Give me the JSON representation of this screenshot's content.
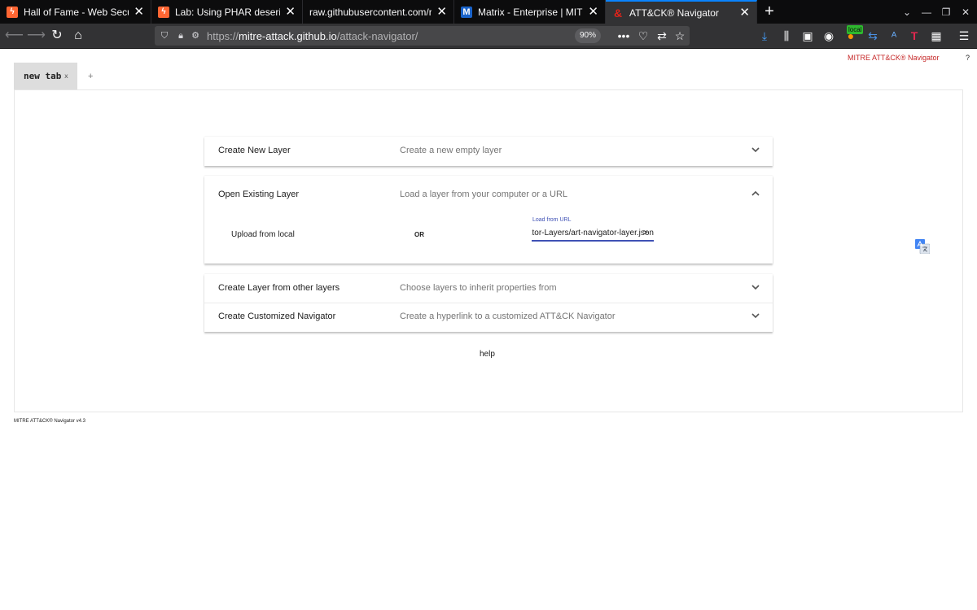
{
  "browser": {
    "tabs": [
      {
        "title": "Hall of Fame - Web Security Ac",
        "favicon": "lightning-icon",
        "active": false
      },
      {
        "title": "Lab: Using PHAR deserialization",
        "favicon": "lightning-icon",
        "active": false
      },
      {
        "title": "raw.githubusercontent.com/redcan",
        "favicon": "",
        "active": false
      },
      {
        "title": "Matrix - Enterprise | MITRE ATT",
        "favicon": "M",
        "active": false
      },
      {
        "title": "ATT&CK® Navigator",
        "favicon": "ampersand-icon",
        "active": true
      }
    ],
    "tab_close_glyph": "✕",
    "favicon_lightning": "ϟ",
    "favicon_m": "M",
    "favicon_amp": "&",
    "url_scheme": "https://",
    "url_host": "mitre-attack.github.io",
    "url_path": "/attack-navigator/",
    "zoom": "90%",
    "local_badge": "local",
    "accent_color": "#0a84ff"
  },
  "app": {
    "brand_link": "MITRE ATT&CK® Navigator",
    "help_q": "?",
    "layer_tab": {
      "label": "new tab",
      "close": "x"
    },
    "add_tab": "+",
    "sections": {
      "create_new": {
        "title": "Create New Layer",
        "desc": "Create a new empty layer"
      },
      "open_existing": {
        "title": "Open Existing Layer",
        "desc": "Load a layer from your computer or a URL",
        "upload_label": "Upload from local",
        "or_label": "OR",
        "url_label": "Load from URL",
        "url_value": "https://raw.githubusercontent.com/redcanaryco/atomic-red-team/master/atomics/Indexes/Attack-Navigator-Layers/art-navigator-layer.json",
        "submit": ">"
      },
      "from_layers": {
        "title": "Create Layer from other layers",
        "desc": "Choose layers to inherit properties from"
      },
      "customized": {
        "title": "Create Customized Navigator",
        "desc": "Create a hyperlink to a customized ATT&CK Navigator"
      }
    },
    "help": "help",
    "footer_version": "MITRE ATT&CK® Navigator v4.3",
    "brand_color": "#c62828",
    "input_accent": "#3f51b5"
  }
}
